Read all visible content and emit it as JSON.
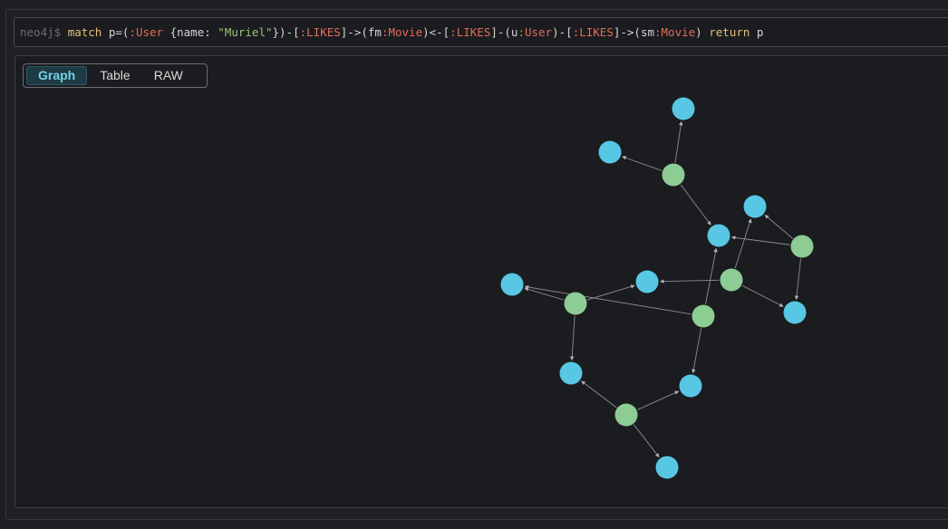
{
  "query": {
    "prompt": "neo4j$",
    "tokens": [
      {
        "t": "match",
        "c": "kw"
      },
      {
        "t": " p=(",
        "c": "punct"
      },
      {
        "t": ":User",
        "c": "label"
      },
      {
        "t": " {name: ",
        "c": "punct"
      },
      {
        "t": "\"Muriel\"",
        "c": "str"
      },
      {
        "t": "})-[",
        "c": "punct"
      },
      {
        "t": ":LIKES",
        "c": "label"
      },
      {
        "t": "]->(fm",
        "c": "punct"
      },
      {
        "t": ":Movie",
        "c": "label"
      },
      {
        "t": ")<-[",
        "c": "punct"
      },
      {
        "t": ":LIKES",
        "c": "label"
      },
      {
        "t": "]-(u",
        "c": "punct"
      },
      {
        "t": ":User",
        "c": "label"
      },
      {
        "t": ")-[",
        "c": "punct"
      },
      {
        "t": ":LIKES",
        "c": "label"
      },
      {
        "t": "]->(sm",
        "c": "punct"
      },
      {
        "t": ":Movie",
        "c": "label"
      },
      {
        "t": ") ",
        "c": "punct"
      },
      {
        "t": "return",
        "c": "kw"
      },
      {
        "t": " p",
        "c": "punct"
      }
    ]
  },
  "tabs": [
    {
      "label": "Graph",
      "active": true
    },
    {
      "label": "Table",
      "active": false
    },
    {
      "label": "RAW",
      "active": false
    }
  ],
  "colors": {
    "movie_node": "#57c7e3",
    "user_node": "#8dcc93",
    "edge": "#8a8d92"
  },
  "graph": {
    "nodes": [
      {
        "id": "m1",
        "type": "movie"
      },
      {
        "id": "m2",
        "type": "movie"
      },
      {
        "id": "m3",
        "type": "movie"
      },
      {
        "id": "m4",
        "type": "movie"
      },
      {
        "id": "m5",
        "type": "movie"
      },
      {
        "id": "m6",
        "type": "movie"
      },
      {
        "id": "m7",
        "type": "movie"
      },
      {
        "id": "m8",
        "type": "movie"
      },
      {
        "id": "m9",
        "type": "movie"
      },
      {
        "id": "m10",
        "type": "movie"
      },
      {
        "id": "m11",
        "type": "movie"
      },
      {
        "id": "u1",
        "type": "user"
      },
      {
        "id": "u2",
        "type": "user"
      },
      {
        "id": "u3",
        "type": "user"
      },
      {
        "id": "u4",
        "type": "user"
      },
      {
        "id": "u5",
        "type": "user"
      },
      {
        "id": "u6",
        "type": "user"
      }
    ],
    "edges": [
      {
        "from": "u1",
        "to": "m1"
      },
      {
        "from": "u1",
        "to": "m2"
      },
      {
        "from": "u1",
        "to": "m4"
      },
      {
        "from": "u2",
        "to": "m3"
      },
      {
        "from": "u2",
        "to": "m4"
      },
      {
        "from": "u2",
        "to": "m8"
      },
      {
        "from": "u3",
        "to": "m6"
      },
      {
        "from": "u3",
        "to": "m3"
      },
      {
        "from": "u3",
        "to": "m8"
      },
      {
        "from": "u4",
        "to": "m6"
      },
      {
        "from": "u4",
        "to": "m5"
      },
      {
        "from": "u4",
        "to": "m9"
      },
      {
        "from": "u5",
        "to": "m5"
      },
      {
        "from": "u5",
        "to": "m4"
      },
      {
        "from": "u5",
        "to": "m10"
      },
      {
        "from": "u6",
        "to": "m9"
      },
      {
        "from": "u6",
        "to": "m10"
      },
      {
        "from": "u6",
        "to": "m11"
      }
    ]
  }
}
